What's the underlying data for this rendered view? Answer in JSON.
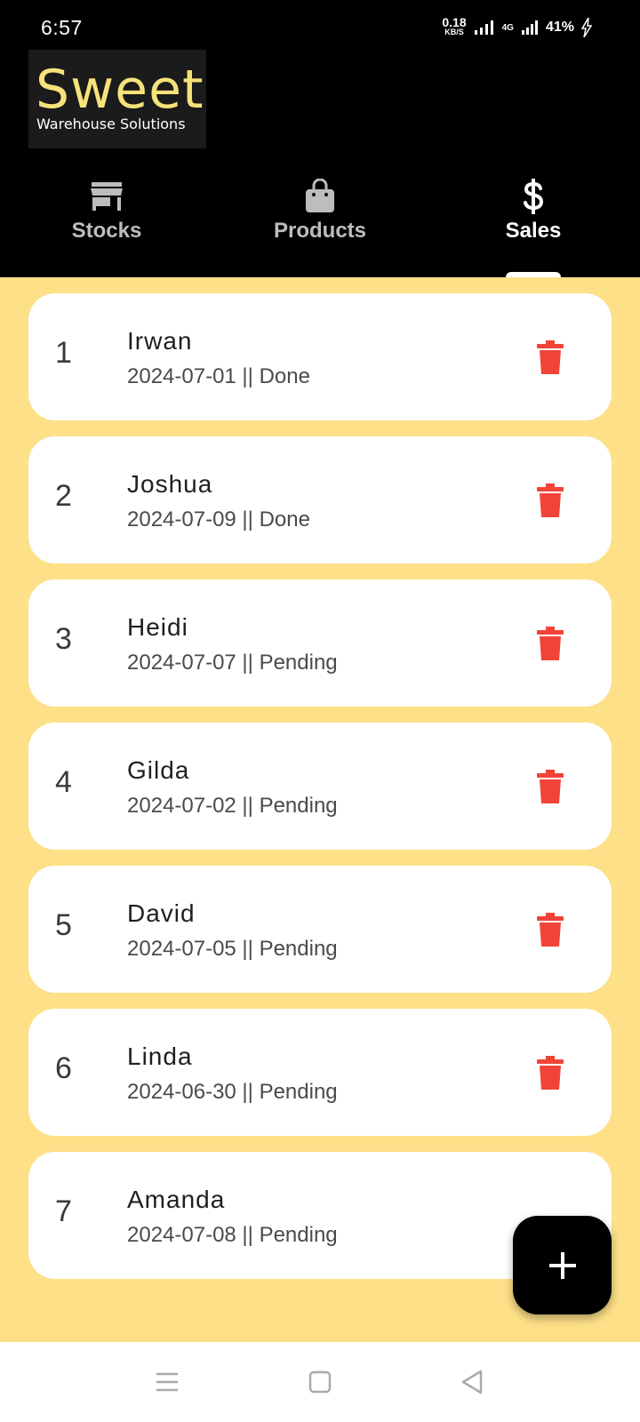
{
  "status_bar": {
    "time": "6:57",
    "net_speed_value": "0.18",
    "net_speed_unit": "KB/S",
    "network": "4G",
    "battery": "41%"
  },
  "logo": {
    "title": "Sweet",
    "subtitle": "Warehouse Solutions"
  },
  "tabs": [
    {
      "label": "Stocks",
      "icon": "store-icon",
      "active": false
    },
    {
      "label": "Products",
      "icon": "shopping-bag-icon",
      "active": false
    },
    {
      "label": "Sales",
      "icon": "dollar-icon",
      "active": true
    }
  ],
  "sales": [
    {
      "index": "1",
      "name": "Irwan",
      "meta": "2024-07-01 || Done"
    },
    {
      "index": "2",
      "name": "Joshua",
      "meta": "2024-07-09 || Done"
    },
    {
      "index": "3",
      "name": "Heidi",
      "meta": "2024-07-07 || Pending"
    },
    {
      "index": "4",
      "name": "Gilda",
      "meta": "2024-07-02 || Pending"
    },
    {
      "index": "5",
      "name": "David",
      "meta": "2024-07-05 || Pending"
    },
    {
      "index": "6",
      "name": "Linda",
      "meta": "2024-06-30 || Pending"
    },
    {
      "index": "7",
      "name": "Amanda",
      "meta": "2024-07-08 || Pending"
    }
  ],
  "colors": {
    "accent_yellow": "#fde087",
    "logo_yellow": "#f6e27a",
    "delete_red": "#f04438",
    "header_black": "#000000"
  },
  "fab": {
    "icon": "plus-icon"
  },
  "nav": {
    "icons": [
      "menu-icon",
      "home-icon",
      "back-icon"
    ]
  }
}
